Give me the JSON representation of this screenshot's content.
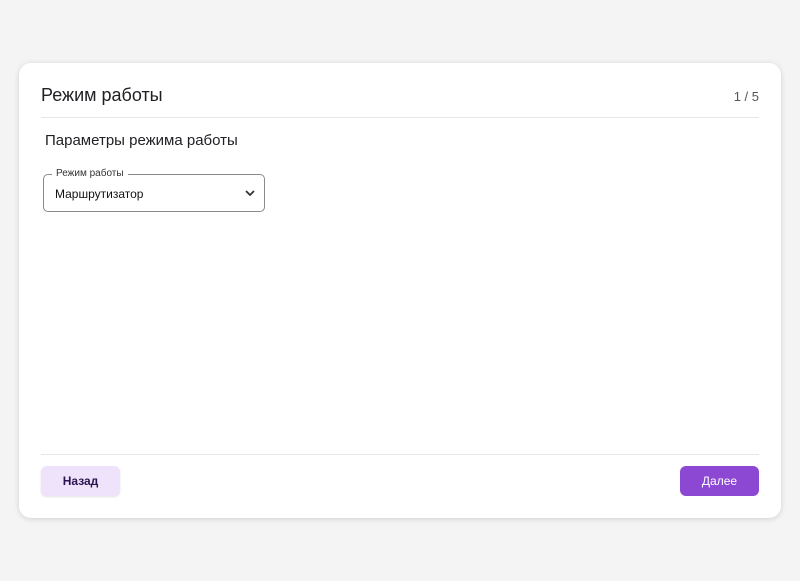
{
  "dialog": {
    "title": "Режим работы",
    "step": "1 / 5"
  },
  "section": {
    "title": "Параметры режима работы"
  },
  "mode_select": {
    "label": "Режим работы",
    "value": "Маршрутизатор",
    "icon": "chevron-down-icon"
  },
  "footer": {
    "back_label": "Назад",
    "next_label": "Далее"
  },
  "colors": {
    "accent": "#8c47d3",
    "secondary_bg": "#efe3fb",
    "page_bg": "#f4f4f4"
  }
}
